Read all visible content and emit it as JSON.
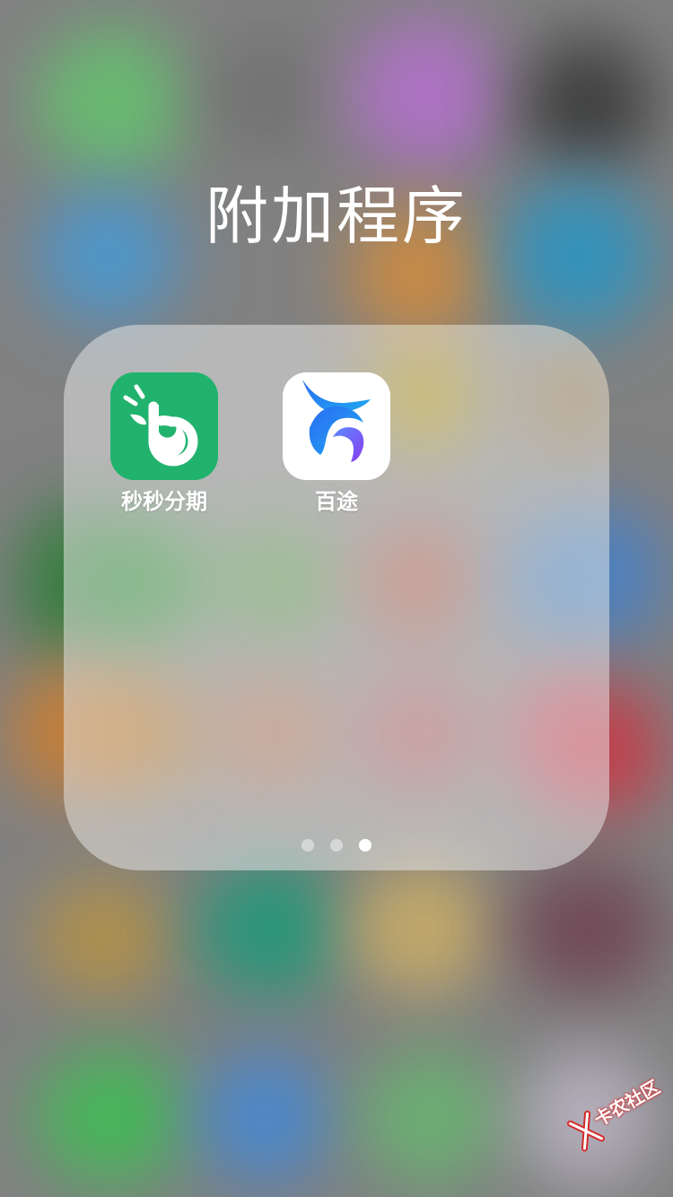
{
  "folder": {
    "title": "附加程序",
    "apps": [
      {
        "label": "秒秒分期",
        "icon": "miaomiao-fenqi-app-icon",
        "icon_color": "#21B36E"
      },
      {
        "label": "百途",
        "icon": "baitu-app-icon",
        "icon_color": "#FFFFFF"
      }
    ],
    "page_indicator": {
      "pages": 3,
      "current": 3
    }
  },
  "watermark": {
    "text": "卡农社区",
    "icon": "kanong-logo-icon"
  }
}
